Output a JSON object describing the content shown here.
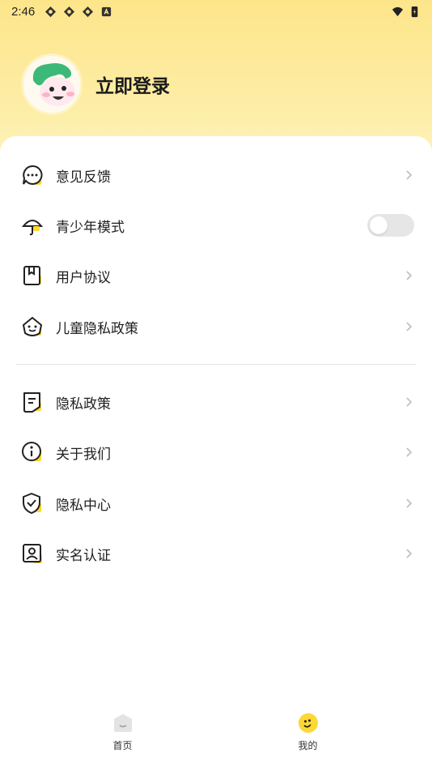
{
  "status_bar": {
    "time": "2:46"
  },
  "header": {
    "login_label": "立即登录"
  },
  "menu": [
    {
      "label": "意见反馈",
      "icon": "feedback-chat-icon"
    },
    {
      "label": "青少年模式",
      "icon": "umbrella-icon",
      "toggle": false
    },
    {
      "label": "用户协议",
      "icon": "book-icon"
    },
    {
      "label": "儿童隐私政策",
      "icon": "child-face-icon"
    },
    {
      "label": "隐私政策",
      "icon": "document-icon"
    },
    {
      "label": "关于我们",
      "icon": "info-icon"
    },
    {
      "label": "隐私中心",
      "icon": "shield-check-icon"
    },
    {
      "label": "实名认证",
      "icon": "id-card-icon"
    }
  ],
  "bottom_nav": [
    {
      "label": "首页",
      "icon": "home-icon"
    },
    {
      "label": "我的",
      "icon": "smiley-icon",
      "active": true
    }
  ],
  "colors": {
    "accent": "#fdd835",
    "bg_top": "#fde58a"
  }
}
